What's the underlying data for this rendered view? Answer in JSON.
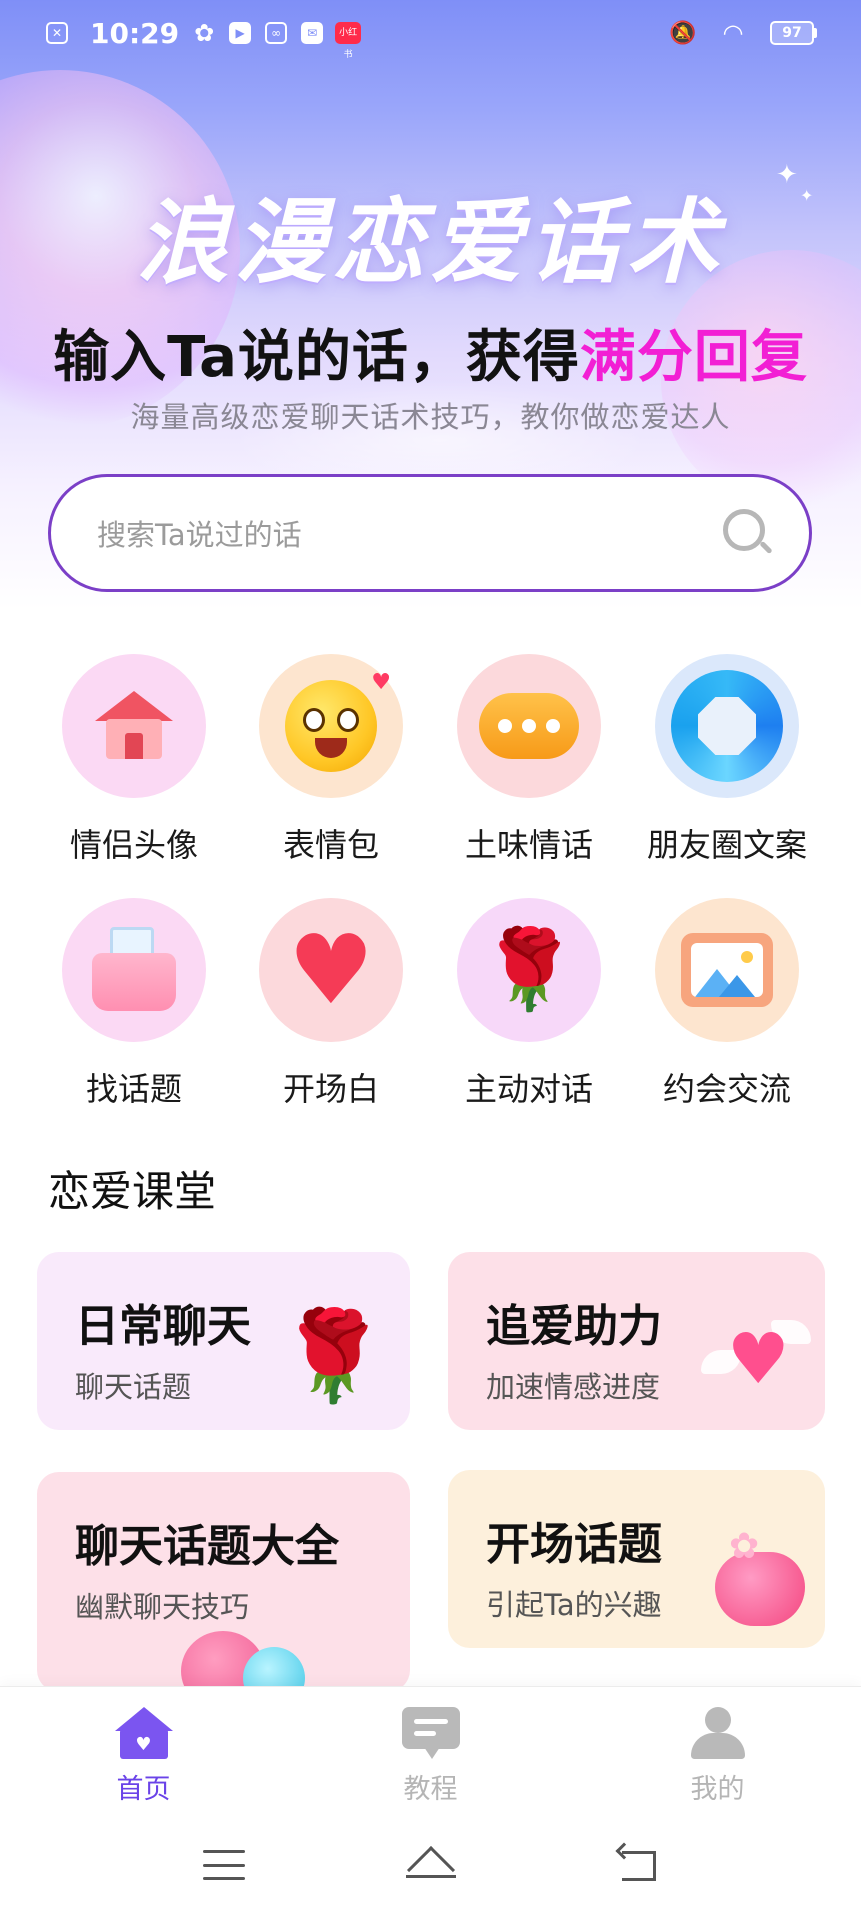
{
  "status_bar": {
    "time": "10:29",
    "battery": "97",
    "notification_icons": [
      "sim-icon",
      "pinwheel-icon",
      "video-icon",
      "app-icon",
      "mail-icon",
      "news-badge-icon"
    ],
    "news_badge": "小红书"
  },
  "hero": {
    "title": "浪漫恋爱话术",
    "headline_prefix": "输入Ta说的话，获得",
    "headline_accent": "满分回复",
    "subtitle": "海量高级恋爱聊天话术技巧，教你做恋爱达人",
    "accent_color": "#f21fd4"
  },
  "search": {
    "placeholder": "搜索Ta说过的话",
    "border_color": "#7b3fc7"
  },
  "categories": [
    {
      "label": "情侣头像",
      "icon": "house-icon"
    },
    {
      "label": "表情包",
      "icon": "emoji-face-icon"
    },
    {
      "label": "土味情话",
      "icon": "chat-bubble-icon"
    },
    {
      "label": "朋友圈文案",
      "icon": "ring-icon"
    },
    {
      "label": "找话题",
      "icon": "pocket-icon"
    },
    {
      "label": "开场白",
      "icon": "heart-icon"
    },
    {
      "label": "主动对话",
      "icon": "rose-icon"
    },
    {
      "label": "约会交流",
      "icon": "photo-icon"
    }
  ],
  "section": {
    "title": "恋爱课堂"
  },
  "cards": [
    {
      "title": "日常聊天",
      "subtitle": "聊天话题"
    },
    {
      "title": "追爱助力",
      "subtitle": "加速情感进度"
    },
    {
      "title": "聊天话题大全",
      "subtitle": "幽默聊天技巧"
    },
    {
      "title": "开场话题",
      "subtitle": "引起Ta的兴趣"
    }
  ],
  "bottom_nav": {
    "items": [
      {
        "label": "首页",
        "active": true
      },
      {
        "label": "教程",
        "active": false
      },
      {
        "label": "我的",
        "active": false
      }
    ],
    "active_color": "#6a43e8"
  }
}
